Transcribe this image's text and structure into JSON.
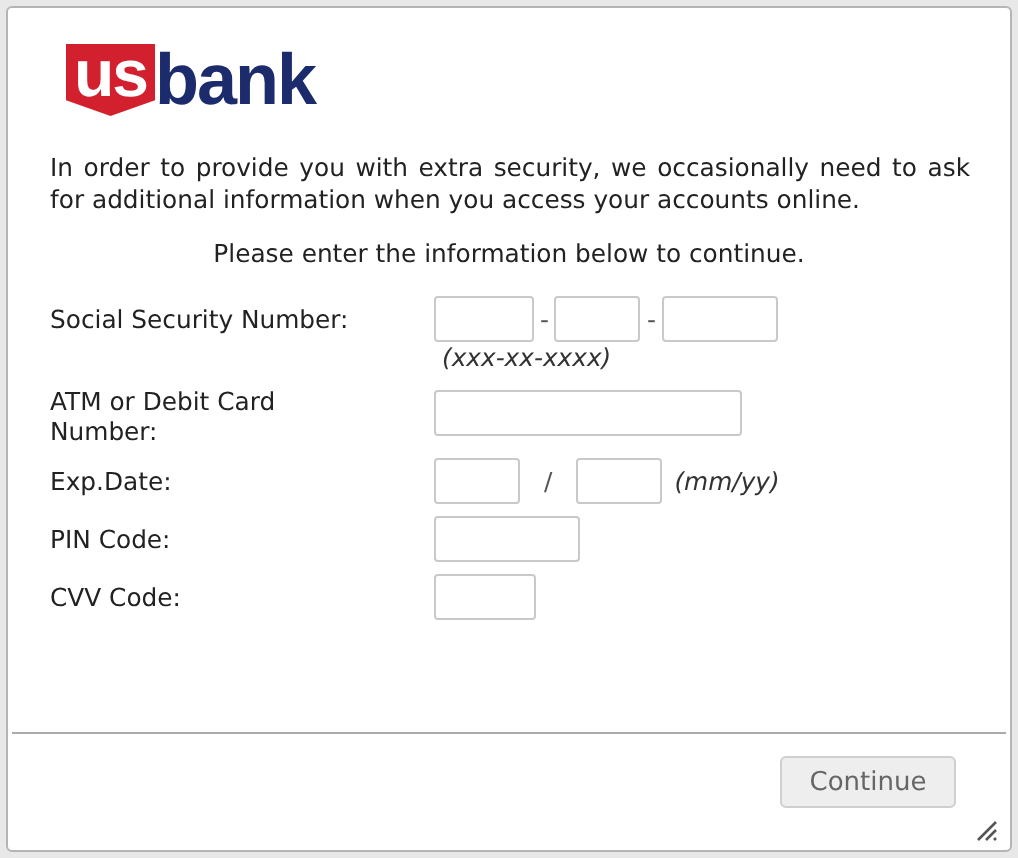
{
  "logo": {
    "part_1": "us",
    "part_2": "bank"
  },
  "intro": "In order to provide you with extra security, we occasionally need to ask for additional information when you access your accounts online.",
  "instruction": "Please enter the information below to continue.",
  "rows": [
    {
      "kind": "ssn",
      "label": "Social Security Number:",
      "separators": [
        "-",
        "-"
      ],
      "hint": "(xxx-xx-xxxx)"
    },
    {
      "kind": "card",
      "label": "ATM or Debit Card Number:"
    },
    {
      "kind": "date",
      "label": "Exp.Date:",
      "separators": [
        "/"
      ],
      "hint": "(mm/yy)"
    },
    {
      "kind": "pin",
      "label": "PIN Code:"
    },
    {
      "kind": "cvv",
      "label": "CVV Code:"
    }
  ],
  "buttons": [
    "Continue"
  ]
}
